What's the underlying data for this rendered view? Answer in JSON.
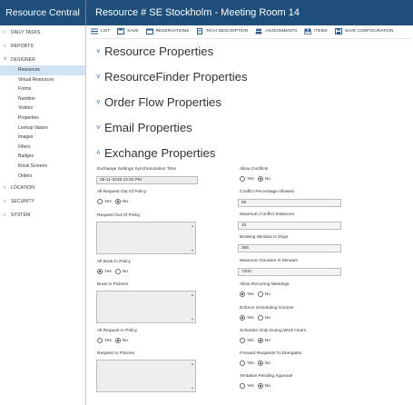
{
  "app": {
    "brand": "Resource Central",
    "title": "Resource # SE Stockholm - Meeting Room 14"
  },
  "sidebar": {
    "sections": [
      {
        "label": "DAILY TASKS",
        "expanded": false
      },
      {
        "label": "REPORTS",
        "expanded": false
      },
      {
        "label": "DESIGNER",
        "expanded": true
      },
      {
        "label": "LOCATION",
        "expanded": false
      },
      {
        "label": "SECURITY",
        "expanded": false
      },
      {
        "label": "SYSTEM",
        "expanded": false
      }
    ],
    "designer_items": [
      "Resources",
      "Virtual Resources",
      "Forms",
      "Nutrition",
      "Visitors",
      "Properties",
      "Lookup Values",
      "Images",
      "Filters",
      "Badges",
      "Kiosk Screens",
      "Orders"
    ],
    "active_item": "Resources"
  },
  "toolbar": {
    "items": [
      {
        "label": "LIST",
        "icon": "list-icon"
      },
      {
        "label": "SAVE",
        "icon": "save-icon"
      },
      {
        "label": "RESERVATIONS",
        "icon": "calendar-icon"
      },
      {
        "label": "RICH DESCRIPTION",
        "icon": "document-icon"
      },
      {
        "label": "ASSIGNMENTS",
        "icon": "assignments-icon"
      },
      {
        "label": "ITEMS",
        "icon": "items-icon"
      },
      {
        "label": "SAVE CONFIGURATION",
        "icon": "save-config-icon"
      }
    ]
  },
  "sections": {
    "resource": "Resource Properties",
    "finder": "ResourceFinder Properties",
    "order_flow": "Order Flow Properties",
    "email": "Email Properties",
    "exchange": "Exchange Properties"
  },
  "exchange": {
    "left": {
      "sync_time_label": "Exchange Settings Synchronization Time",
      "sync_time_value": "26-11-2018 12:32 PM",
      "all_request_out_label": "All Request Out Of Policy",
      "all_request_out_value": "No",
      "request_out_label": "Request Out Of Policy",
      "all_book_in_label": "All Book In Policy",
      "all_book_in_value": "Yes",
      "book_in_label": "Book In Policies",
      "all_request_in_label": "All Request In Policy",
      "all_request_in_value": "No",
      "request_in_label": "Request In Policies"
    },
    "right": {
      "allow_conflicts_label": "Allow Conflicts",
      "allow_conflicts_value": "No",
      "conflict_pct_label": "Conflict Percentage Allowed",
      "conflict_pct_value": "50",
      "max_conflict_label": "Maximum Conflict Instances",
      "max_conflict_value": "10",
      "booking_window_label": "Booking Window In Days",
      "booking_window_value": "365",
      "max_duration_label": "Maximum Duration In Minutes",
      "max_duration_value": "7200",
      "allow_recurring_label": "Allow Recurring Meetings",
      "allow_recurring_value": "Yes",
      "enforce_horizon_label": "Enforce Scheduling Horizon",
      "enforce_horizon_value": "Yes",
      "work_hours_label": "Schedule Only During Work Hours",
      "work_hours_value": "No",
      "forward_label": "Forward Requests To Delegates",
      "forward_value": "No",
      "tentative_label": "Tentative Pending Approval",
      "tentative_value": "No"
    },
    "yes_label": "Yes",
    "no_label": "No"
  },
  "colors": {
    "header": "#1d4f7a",
    "active_nav": "#cfe3f3",
    "accent": "#2a6aa8"
  }
}
